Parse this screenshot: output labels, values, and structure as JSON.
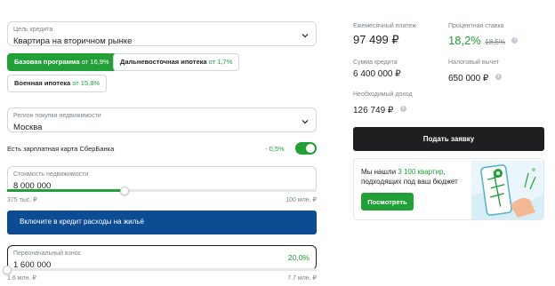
{
  "purpose": {
    "label": "Цель кредита",
    "value": "Квартира на вторичном рынке"
  },
  "programs": [
    {
      "name": "Базовая программа",
      "rate": "от 16,9%"
    },
    {
      "name": "Дальневосточная ипотека",
      "rate": "от 1,7%"
    },
    {
      "name": "Военная ипотека",
      "rate": "от 15,8%"
    }
  ],
  "region": {
    "label": "Регион покупки недвижимости",
    "value": "Москва"
  },
  "salary_card": {
    "label": "Есть зарплатная карта СберБанка",
    "discount": "- 0,5%"
  },
  "property_cost": {
    "label": "Стоимость недвижимости",
    "value": "8 000 000",
    "min": "375 тыс. ₽",
    "max": "100 млн. ₽",
    "fill_percent": 38
  },
  "expenses_banner": {
    "text": "Включите в кредит расходы на жильё"
  },
  "down_payment": {
    "label": "Первоначальный взнос",
    "value": "1 600 000",
    "percent": "20,0%",
    "min": "1.6 млн. ₽",
    "max": "7.7 млн. ₽",
    "fill_percent": 0
  },
  "summary": {
    "monthly_label": "Ежемесячный платеж",
    "monthly_value": "97 499 ₽",
    "rate_label": "Процентная ставка",
    "rate_value": "18,2%",
    "rate_old": "18,5%",
    "loan_label": "Сумма кредита",
    "loan_value": "6 400 000 ₽",
    "tax_label": "Налоговый вычет",
    "tax_value": "650 000 ₽",
    "income_label": "Необходимый доход",
    "income_value": "126 749 ₽"
  },
  "apply_button": "Подать заявку",
  "promo": {
    "text_before": "Мы нашли ",
    "highlight": "3 100 квартир",
    "text_after": ",",
    "line2": "подходящих под ваш бюджет",
    "button": "Посмотреть"
  },
  "colors": {
    "accent": "#21a038",
    "banner": "#0b4c93",
    "dark": "#1f1f22"
  }
}
